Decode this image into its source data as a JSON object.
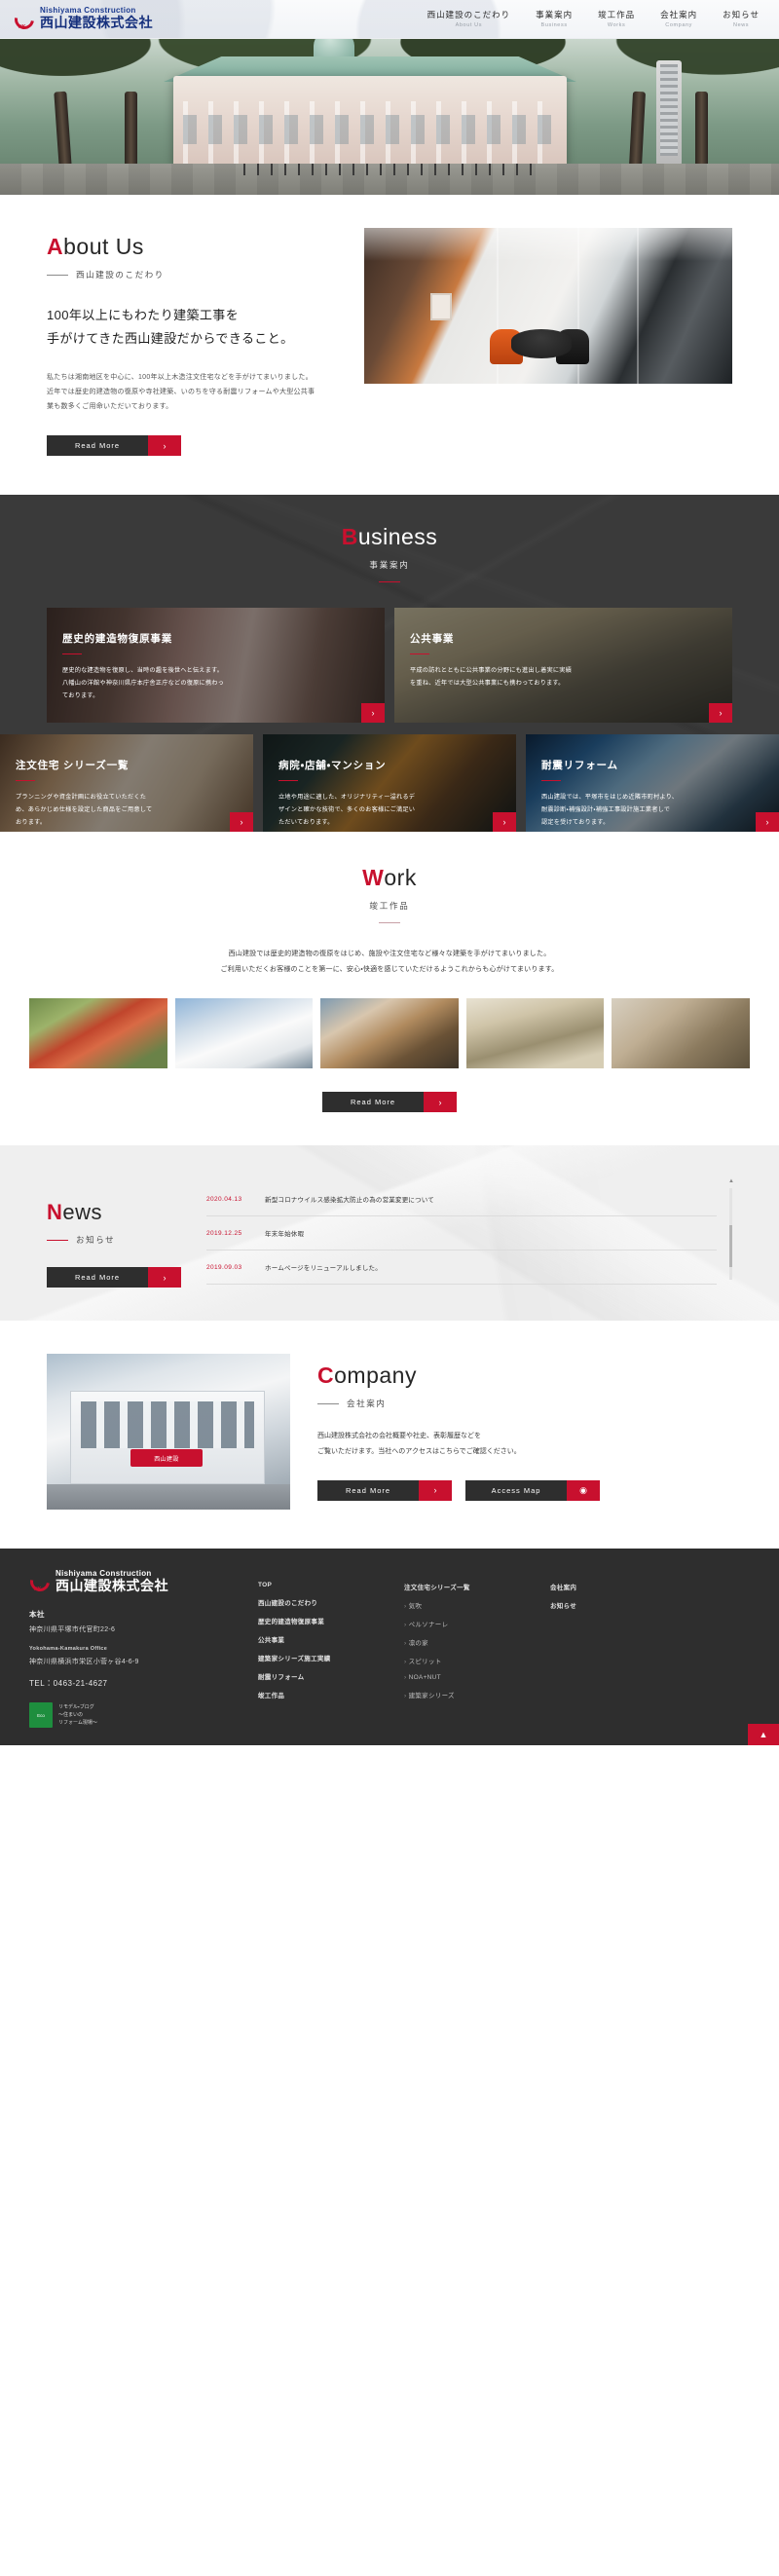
{
  "header": {
    "logo": {
      "en": "Nishiyama Construction",
      "jp": "西山建設株式会社",
      "mark": "NK"
    },
    "nav": [
      {
        "jp": "西山建設のこだわり",
        "en": "About Us"
      },
      {
        "jp": "事業案内",
        "en": "Business"
      },
      {
        "jp": "竣工作品",
        "en": "Works"
      },
      {
        "jp": "会社案内",
        "en": "Company"
      },
      {
        "jp": "お知らせ",
        "en": "News"
      }
    ]
  },
  "about": {
    "title_cap": "A",
    "title_rest": "bout Us",
    "sub": "西山建設のこだわり",
    "lead_line1": "100年以上にもわたり建築工事を",
    "lead_line2": "手がけてきた西山建設だからできること。",
    "body_line1": "私たちは湘南地区を中心に、100年以上木造注文住宅などを手がけてまいりました。",
    "body_line2": "近年では歴史的建造物の復原や寺社建築、いのちを守る耐震リフォームや大型公共事",
    "body_line3": "業も数多くご用命いただいております。",
    "button": "Read More"
  },
  "business": {
    "title_cap": "B",
    "title_rest": "usiness",
    "sub": "事業案内",
    "cards_row1": [
      {
        "title": "歴史的建造物復原事業",
        "desc_line1": "歴史的な建造物を復原し、当時の趣を後世へと伝えます。",
        "desc_line2": "八幡山の洋館や神奈川県庁本庁舎正庁などの復原に携わっ",
        "desc_line3": "ております。"
      },
      {
        "title": "公共事業",
        "desc_line1": "平成の訪れとともに公共事業の分野にも進出し着実に実績",
        "desc_line2": "を重ね、近年では大型公共事業にも携わっております。",
        "desc_line3": ""
      }
    ],
    "cards_row2": [
      {
        "title": "注文住宅 シリーズ一覧",
        "desc_line1": "プランニングや資金計画にお役立ていただくた",
        "desc_line2": "め、あらかじめ仕様を設定した商品をご用意して",
        "desc_line3": "おります。"
      },
      {
        "title": "病院・店舗・マンション",
        "desc_line1": "立地や用途に適した、オリジナリティー溢れるデ",
        "desc_line2": "ザインと確かな技術で、多くのお客様にご満足い",
        "desc_line3": "ただいております。"
      },
      {
        "title": "耐震リフォーム",
        "desc_line1": "西山建設では、平塚市をはじめ近隣市町村より、",
        "desc_line2": "耐震診断・補強設計・補強工事設計施工業者しで",
        "desc_line3": "認定を受けております。"
      }
    ],
    "arrow": "›"
  },
  "work": {
    "title_cap": "W",
    "title_rest": "ork",
    "sub": "竣工作品",
    "desc_line1": "西山建設では歴史的建造物の復原をはじめ、施設や注文住宅など様々な建築を手がけてまいりました。",
    "desc_line2": "ご利用いただくお客様のことを第一に、安心・快適を感じていただけるようこれからも心がけてまいります。",
    "button": "Read More"
  },
  "news": {
    "title_cap": "N",
    "title_rest": "ews",
    "sub": "お知らせ",
    "button": "Read More",
    "items": [
      {
        "date": "2020.04.13",
        "title": "新型コロナウイルス感染拡大防止の為の営業変更について"
      },
      {
        "date": "2019.12.25",
        "title": "年末年始休暇"
      },
      {
        "date": "2019.09.03",
        "title": "ホームページをリニューアルしました。"
      }
    ]
  },
  "company": {
    "title_cap": "C",
    "title_rest": "ompany",
    "sub": "会社案内",
    "desc_line1": "西山建設株式会社の会社概要や社史、表彰履歴などを",
    "desc_line2": "ご覧いただけます。当社へのアクセスはこちらでご確認ください。",
    "button_read": "Read More",
    "button_map": "Access Map",
    "sign_text": "西山建設"
  },
  "footer": {
    "logo": {
      "en": "Nishiyama Construction",
      "jp": "西山建設株式会社",
      "mark": "NK"
    },
    "hq_label": "本社",
    "hq_address": "神奈川県平塚市代官町22-6",
    "office_label": "Yokohama-Kamakura Office",
    "office_address": "神奈川県横浜市栄区小菅ヶ谷4-6-9",
    "tel": "TEL：0463-21-4627",
    "eco_badge": "Eco",
    "blog_line1": "リモデル・ブログ",
    "blog_line2": "〜住まいの",
    "blog_line3": "リフォーム現場〜",
    "col1": [
      "TOP",
      "西山建設のこだわり",
      "歴史的建造物復原事業",
      "公共事業",
      "建築家シリーズ施工実績",
      "耐震リフォーム",
      "竣工作品"
    ],
    "col2_head": "注文住宅シリーズ一覧",
    "col2": [
      "気吹",
      "ペルソナーレ",
      "凛の家",
      "スピリット",
      "NOA+NUT",
      "建築家シリーズ"
    ],
    "col3": [
      "会社案内",
      "お知らせ"
    ],
    "to_top": "▲"
  }
}
